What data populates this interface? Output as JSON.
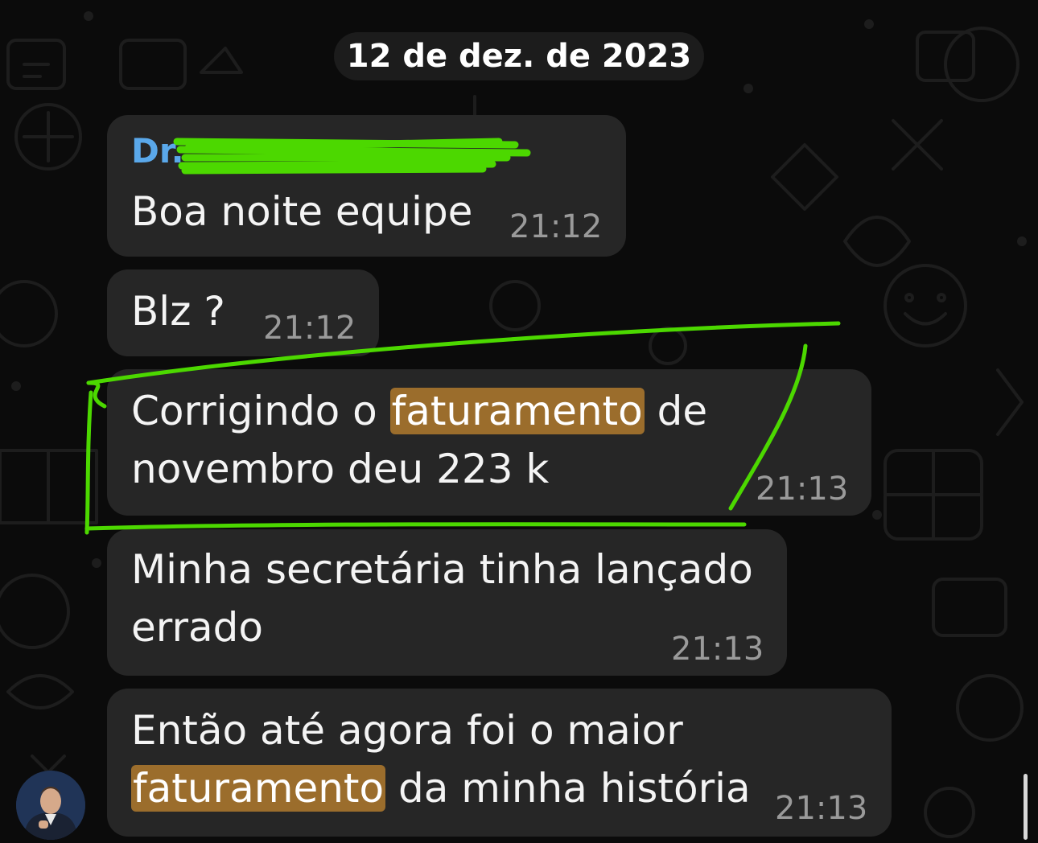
{
  "chat": {
    "date_separator": "12 de dez. de 2023",
    "messages": [
      {
        "sender": "Dr.",
        "text": "Boa noite equipe",
        "time": "21:12"
      },
      {
        "text": "Blz ?",
        "time": "21:12"
      },
      {
        "text_before": "Corrigindo o ",
        "highlight": "faturamento",
        "text_after": " de",
        "line2": "novembro deu 223 k",
        "time": "21:13"
      },
      {
        "line1": "Minha secretária tinha lançado",
        "line2": "errado",
        "time": "21:13"
      },
      {
        "line1": "Então até agora foi o maior",
        "highlight": "faturamento",
        "line2_after": " da minha história",
        "time": "21:13"
      }
    ]
  },
  "colors": {
    "background": "#0b0b0b",
    "bubble": "#262626",
    "sender_name": "#5aa8ea",
    "search_highlight": "#9b6d2c",
    "annotation_green": "#4cd800"
  },
  "icons": {
    "avatar": "sender-avatar-photo",
    "redaction": "green-scribble"
  }
}
